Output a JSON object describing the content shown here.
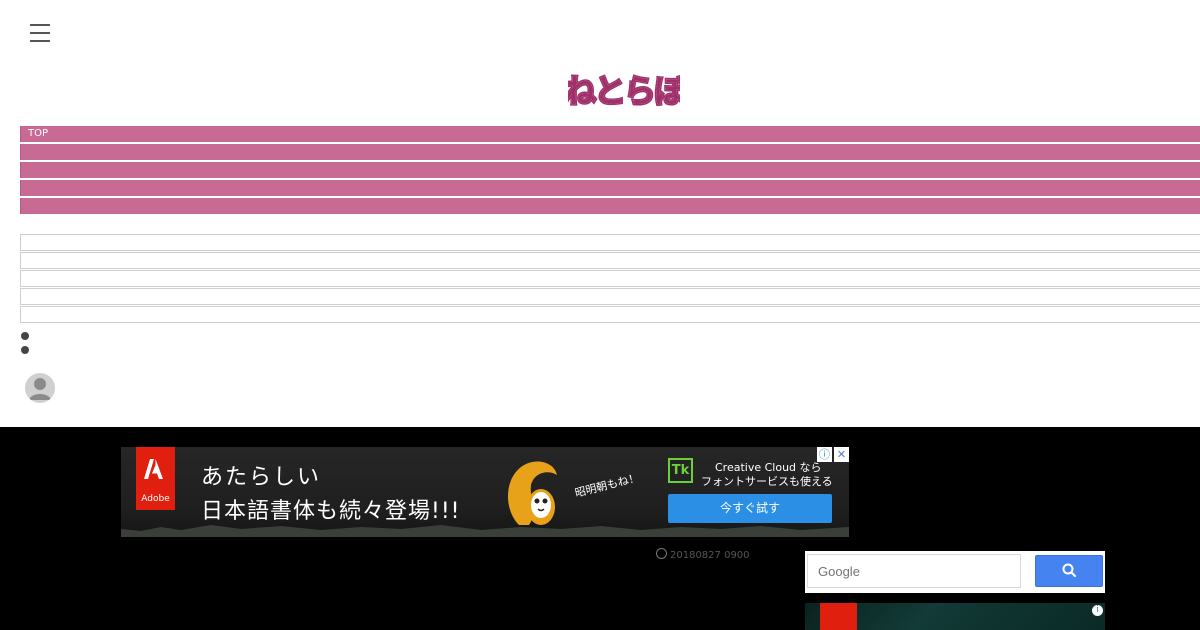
{
  "header": {
    "menu_icon": "hamburger-icon",
    "logo_text": "ねとらぼ",
    "logo_color": "#a0306a"
  },
  "nav": {
    "pink_items": [
      "TOP",
      "",
      "",
      "",
      ""
    ],
    "pink_color": "#c76b94",
    "sub_items": [
      "",
      "",
      "",
      "",
      ""
    ]
  },
  "ad": {
    "brand": "Adobe",
    "headline_line1": "あたらしい",
    "headline_line2": "日本語書体も続々登場!!!",
    "slogan": "昭明朝もね！",
    "product_badge": "Tk",
    "cc_line1": "Creative Cloud なら",
    "cc_line2": "フォントサービスも使える",
    "cta_label": "今すぐ試す",
    "info_icon": "info-icon",
    "close_icon": "close-icon"
  },
  "article": {
    "timestamp": "20180827 0900",
    "clock_icon": "clock-icon"
  },
  "search": {
    "placeholder": "Google",
    "button_icon": "search-icon"
  },
  "side_ad": {
    "info_icon": "info-icon"
  }
}
